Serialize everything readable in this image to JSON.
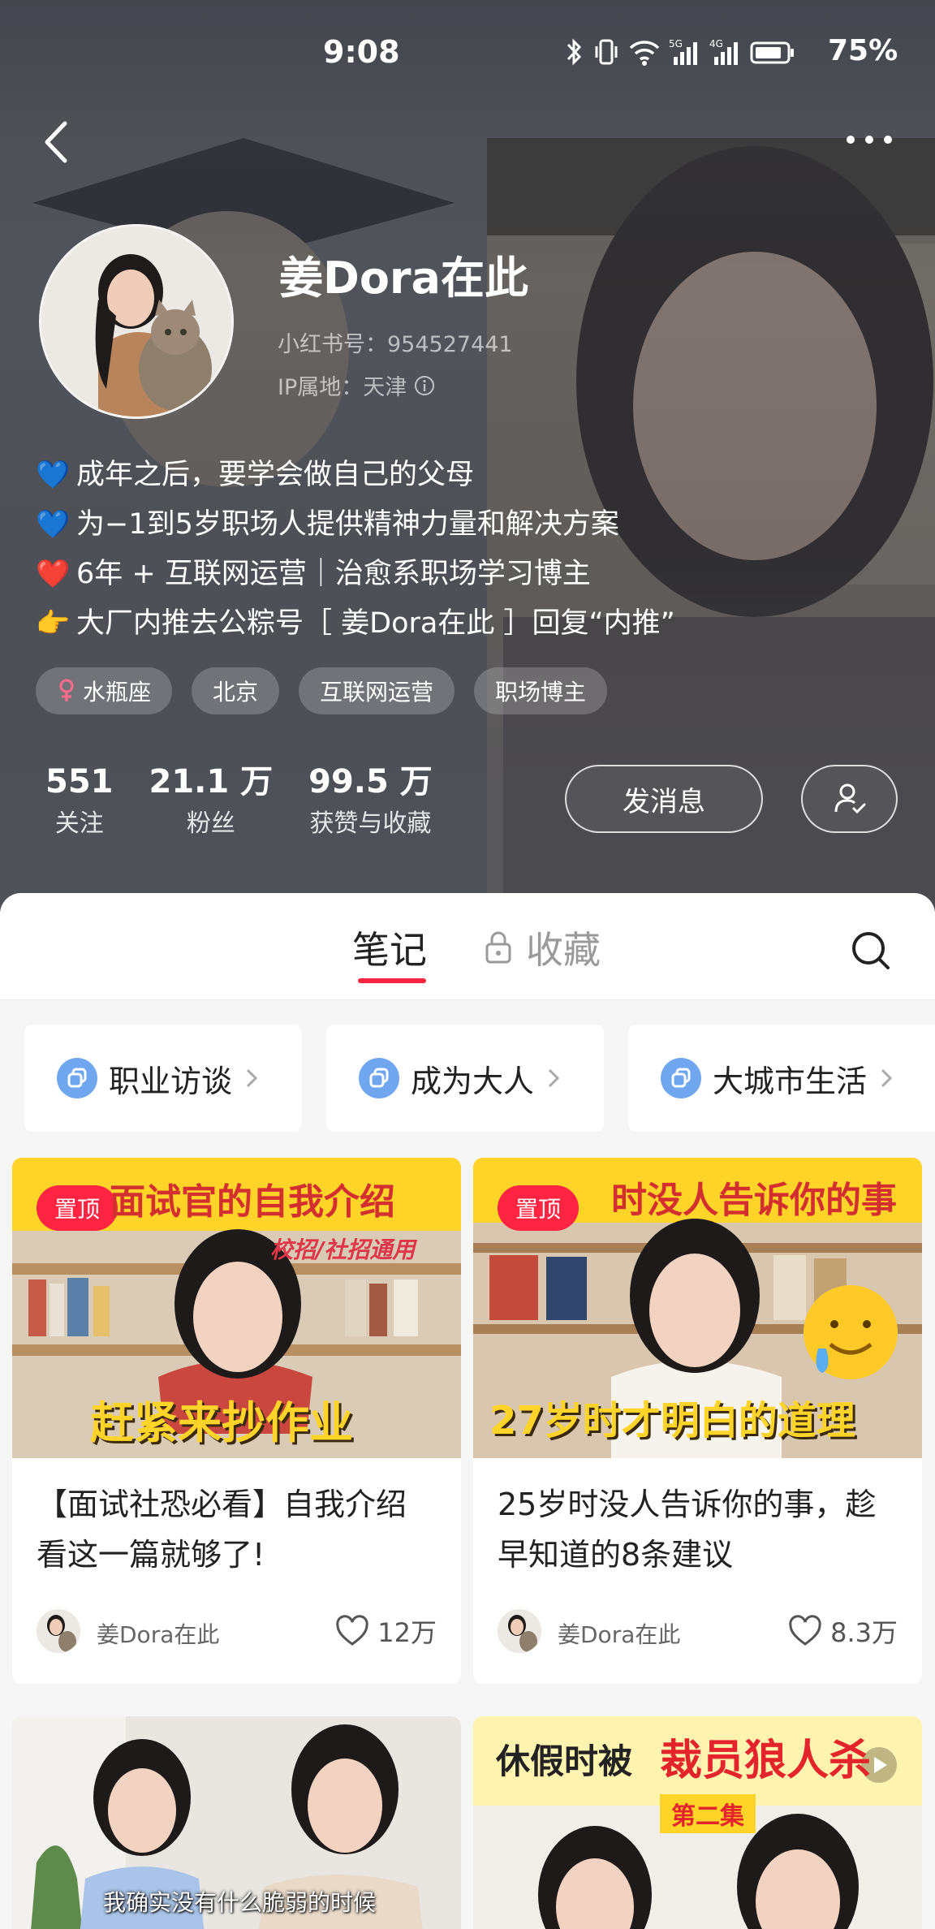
{
  "status_bar": {
    "time": "9:08",
    "battery": "75%"
  },
  "profile": {
    "name": "姜Dora在此",
    "account_id": "小红书号：954527441",
    "ip_location": "IP属地：天津",
    "bio": [
      {
        "emoji": "💙",
        "text": "成年之后，要学会做自己的父母"
      },
      {
        "emoji": "💙",
        "text": "为−1到5岁职场人提供精神力量和解决方案"
      },
      {
        "emoji": "❤️",
        "text": "6年 + 互联网运营｜治愈系职场学习博主"
      },
      {
        "emoji": "👉",
        "text": "大厂内推去公粽号［ 姜Dora在此 ］回复“内推”"
      }
    ],
    "tags": [
      "水瓶座",
      "北京",
      "互联网运营",
      "职场博主"
    ],
    "stats": [
      {
        "value": "551",
        "label": "关注"
      },
      {
        "value": "21.1 万",
        "label": "粉丝"
      },
      {
        "value": "99.5 万",
        "label": "获赞与收藏"
      }
    ],
    "message_button": "发消息"
  },
  "tabs": {
    "notes": "笔记",
    "favorites": "收藏"
  },
  "collections": [
    "职业访谈",
    "成为大人",
    "大城市生活"
  ],
  "notes": [
    {
      "pin": "置顶",
      "cover_headline": "面试官的自我介绍",
      "cover_sub": "校招/社招通用",
      "cover_caption": "赶紧来抄作业",
      "title": "【面试社恐必看】自我介绍看这一篇就够了!",
      "author": "姜Dora在此",
      "likes": "12万"
    },
    {
      "pin": "置顶",
      "cover_headline": "时没人告诉你的事",
      "cover_caption": "27岁时才明白的道理",
      "title": "25岁时没人告诉你的事，趁早知道的8条建议",
      "author": "姜Dora在此",
      "likes": "8.3万"
    },
    {
      "cover_caption": "我确实没有什么脆弱的时候"
    },
    {
      "cover_headline_a": "休假时被",
      "cover_headline_b": "裁员狼人杀",
      "cover_badge": "第二集"
    }
  ],
  "colors": {
    "accent": "#ff2442",
    "collection_icon": "#6fa6ef",
    "cover_yellow": "#ffd428"
  },
  "icons": [
    "back-arrow-icon",
    "more-icon",
    "info-icon",
    "female-icon",
    "follow-user-icon",
    "lock-icon",
    "search-icon",
    "collection-icon",
    "chevron-right-icon",
    "heart-icon",
    "play-icon"
  ]
}
